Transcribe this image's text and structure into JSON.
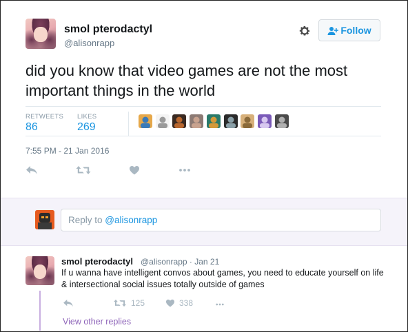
{
  "tweet": {
    "display_name": "smol pterodactyl",
    "handle": "@alisonrapp",
    "follow_label": "Follow",
    "text": "did you know that video games are not the most important things in the world",
    "retweets_label": "RETWEETS",
    "retweets_count": "86",
    "likes_label": "LIKES",
    "likes_count": "269",
    "timestamp": "7:55 PM - 21 Jan 2016"
  },
  "likers": [
    {
      "bg": "#e6a84a",
      "fg": "#3a7ab8"
    },
    {
      "bg": "#f4f4f4",
      "fg": "#9a9a9a"
    },
    {
      "bg": "#3a2a22",
      "fg": "#b8672f"
    },
    {
      "bg": "#8c7a74",
      "fg": "#c9a38f"
    },
    {
      "bg": "#2a7a6a",
      "fg": "#d49a3a"
    },
    {
      "bg": "#2b2b2b",
      "fg": "#8aa0a8"
    },
    {
      "bg": "#d7b07a",
      "fg": "#8a6a3a"
    },
    {
      "bg": "#7a5ab8",
      "fg": "#d8c8f0"
    },
    {
      "bg": "#4a4a4a",
      "fg": "#b0b0b0"
    }
  ],
  "reply_box": {
    "prefix": "Reply to ",
    "mention": "@alisonrapp"
  },
  "reply": {
    "display_name": "smol pterodactyl",
    "meta": "@alisonrapp · Jan 21",
    "text": "If u wanna have intelligent convos about games, you need to educate yourself on life & intersectional social issues totally outside of games",
    "retweets_count": "125",
    "likes_count": "338",
    "view_more": "View other replies"
  },
  "colors": {
    "accent": "#1b95e0",
    "thread": "#c8aee0",
    "view_more": "#8d63b8"
  }
}
